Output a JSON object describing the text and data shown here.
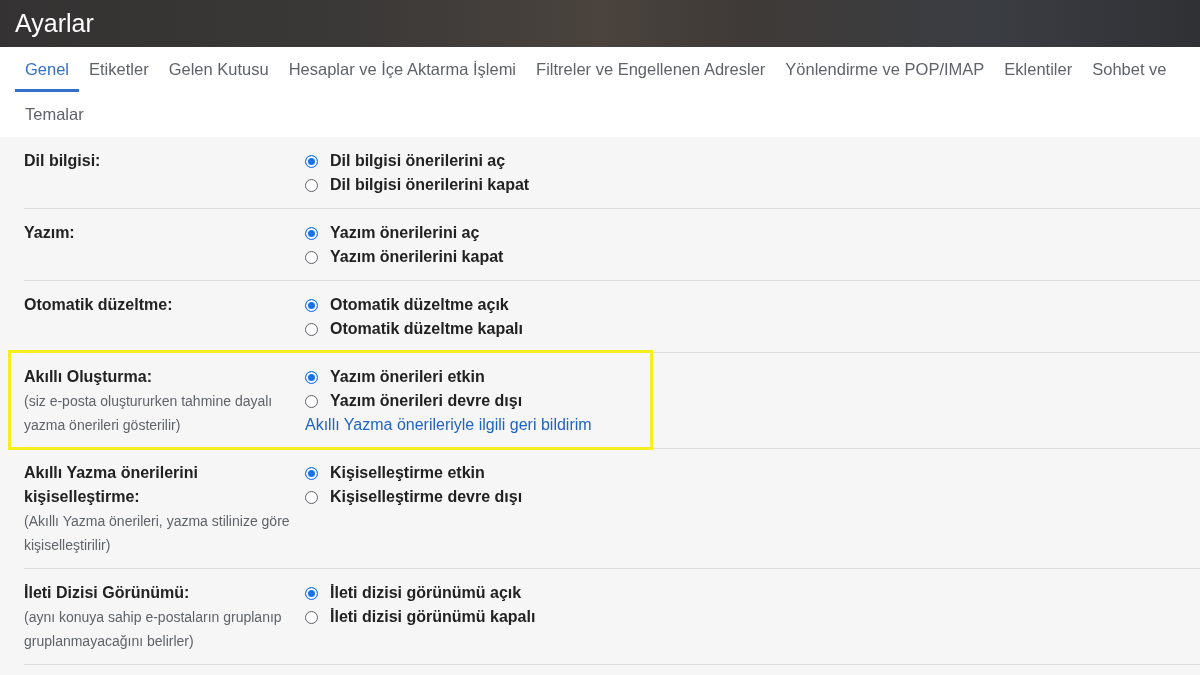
{
  "header": {
    "title": "Ayarlar"
  },
  "tabs": [
    {
      "label": "Genel",
      "selected": true
    },
    {
      "label": "Etiketler",
      "selected": false
    },
    {
      "label": "Gelen Kutusu",
      "selected": false
    },
    {
      "label": "Hesaplar ve İçe Aktarma İşlemi",
      "selected": false
    },
    {
      "label": "Filtreler ve Engellenen Adresler",
      "selected": false
    },
    {
      "label": "Yönlendirme ve POP/IMAP",
      "selected": false
    },
    {
      "label": "Eklentiler",
      "selected": false
    },
    {
      "label": "Sohbet ve",
      "selected": false
    },
    {
      "label": "Temalar",
      "selected": false
    }
  ],
  "settings": [
    {
      "label": "Dil bilgisi:",
      "highlighted": false,
      "options": [
        {
          "label": "Dil bilgisi önerilerini aç",
          "selected": true
        },
        {
          "label": "Dil bilgisi önerilerini kapat",
          "selected": false
        }
      ]
    },
    {
      "label": "Yazım:",
      "highlighted": false,
      "options": [
        {
          "label": "Yazım önerilerini aç",
          "selected": true
        },
        {
          "label": "Yazım önerilerini kapat",
          "selected": false
        }
      ]
    },
    {
      "label": "Otomatik düzeltme:",
      "highlighted": false,
      "options": [
        {
          "label": "Otomatik düzeltme açık",
          "selected": true
        },
        {
          "label": "Otomatik düzeltme kapalı",
          "selected": false
        }
      ]
    },
    {
      "label": "Akıllı Oluşturma:",
      "description": "(siz e-posta oluştururken tahmine dayalı yazma önerileri gösterilir)",
      "highlighted": true,
      "options": [
        {
          "label": "Yazım önerileri etkin",
          "selected": true
        },
        {
          "label": "Yazım önerileri devre dışı",
          "selected": false
        }
      ],
      "link": "Akıllı Yazma önerileriyle ilgili geri bildirim"
    },
    {
      "label": "Akıllı Yazma önerilerini kişiselleştirme:",
      "description": "(Akıllı Yazma önerileri, yazma stilinize göre kişiselleştirilir)",
      "highlighted": false,
      "options": [
        {
          "label": "Kişiselleştirme etkin",
          "selected": true
        },
        {
          "label": "Kişiselleştirme devre dışı",
          "selected": false
        }
      ]
    },
    {
      "label": "İleti Dizisi Görünümü:",
      "description": "(aynı konuya sahip e-postaların gruplanıp gruplanmayacağını belirler)",
      "highlighted": false,
      "options": [
        {
          "label": "İleti dizisi görünümü açık",
          "selected": true
        },
        {
          "label": "İleti dizisi görünümü kapalı",
          "selected": false
        }
      ]
    }
  ]
}
